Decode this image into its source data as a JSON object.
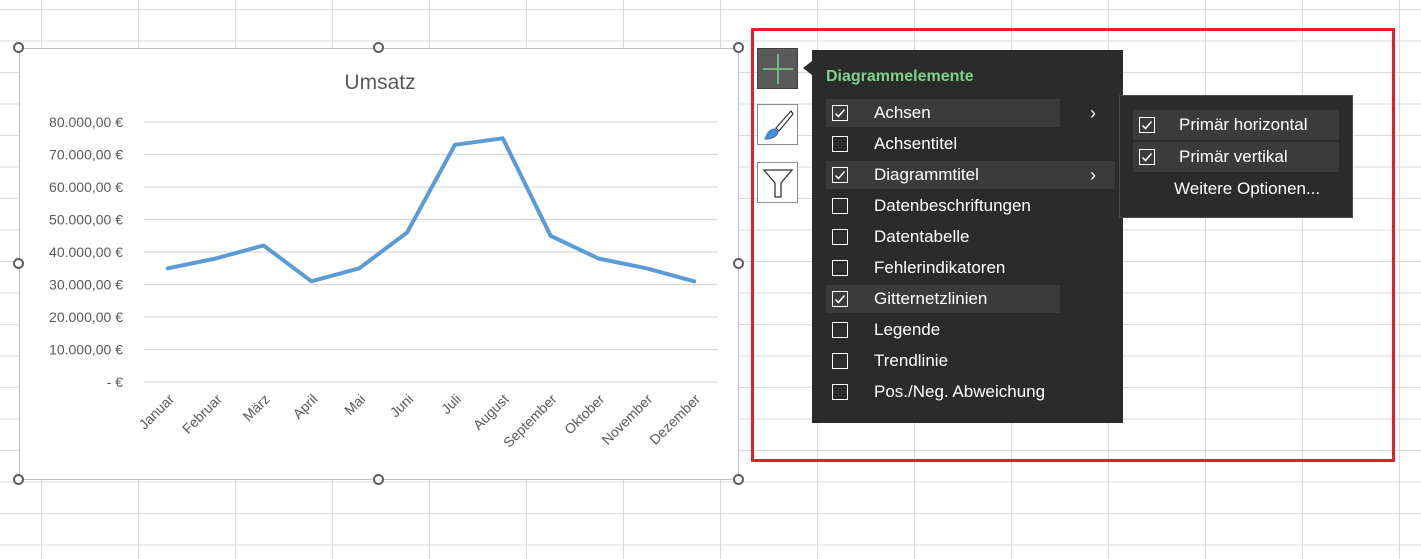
{
  "chart_data": {
    "type": "line",
    "title": "Umsatz",
    "categories": [
      "Januar",
      "Februar",
      "März",
      "April",
      "Mai",
      "Juni",
      "Juli",
      "August",
      "September",
      "Oktober",
      "November",
      "Dezember"
    ],
    "series": [
      {
        "values": [
          35000,
          38000,
          42000,
          31000,
          35000,
          46000,
          73000,
          75000,
          45000,
          38000,
          35000,
          31000
        ],
        "color": "#5b9bd5"
      }
    ],
    "ylim": [
      0,
      80000
    ],
    "yticks": [
      0,
      10000,
      20000,
      30000,
      40000,
      50000,
      60000,
      70000,
      80000
    ],
    "ytick_labels": [
      "-  €",
      "10.000,00 €",
      "20.000,00 €",
      "30.000,00 €",
      "40.000,00 €",
      "50.000,00 €",
      "60.000,00 €",
      "70.000,00 €",
      "80.000,00 €"
    ],
    "grid": true,
    "legend": "none"
  },
  "side_buttons": [
    {
      "icon": "plus-icon",
      "active": true
    },
    {
      "icon": "paintbrush-icon",
      "active": false
    },
    {
      "icon": "filter-icon",
      "active": false
    }
  ],
  "panel": {
    "title": "Diagrammelemente",
    "items": [
      {
        "label": "Achsen",
        "checked": true,
        "submenu": true
      },
      {
        "label": "Achsentitel",
        "checked": false,
        "submenu": false
      },
      {
        "label": "Diagrammtitel",
        "checked": true,
        "submenu": true
      },
      {
        "label": "Datenbeschriftungen",
        "checked": false,
        "submenu": false
      },
      {
        "label": "Datentabelle",
        "checked": false,
        "submenu": false
      },
      {
        "label": "Fehlerindikatoren",
        "checked": false,
        "submenu": false
      },
      {
        "label": "Gitternetzlinien",
        "checked": true,
        "submenu": false
      },
      {
        "label": "Legende",
        "checked": false,
        "submenu": false
      },
      {
        "label": "Trendlinie",
        "checked": false,
        "submenu": false
      },
      {
        "label": "Pos./Neg. Abweichung",
        "checked": false,
        "submenu": false
      }
    ]
  },
  "submenu": {
    "items": [
      {
        "label": "Primär horizontal",
        "checked": true
      },
      {
        "label": "Primär vertikal",
        "checked": true
      }
    ],
    "more_options": "Weitere Optionen..."
  },
  "colors": {
    "accent_green": "#7ed28e",
    "panel_bg": "#2b2b2b",
    "highlight_red": "#e3202a",
    "series_blue": "#5b9bd5"
  }
}
